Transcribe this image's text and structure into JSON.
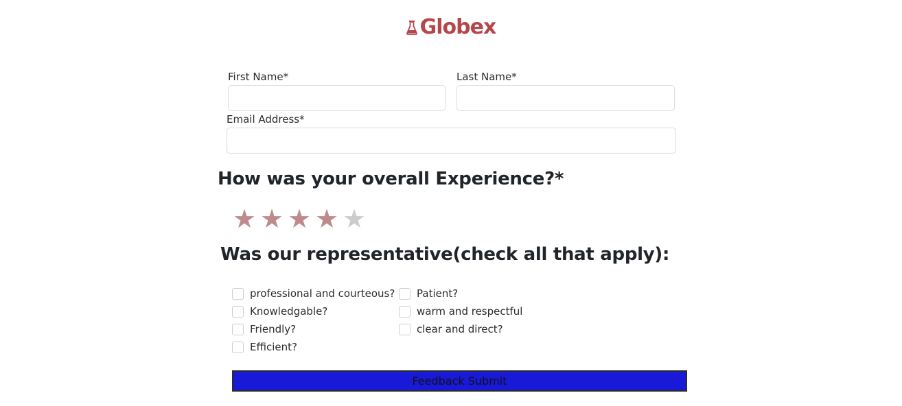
{
  "brand": {
    "name": "Globex",
    "icon": "flask-icon",
    "color": "#b5474b"
  },
  "form": {
    "first_name": {
      "label": "First Name*",
      "value": ""
    },
    "last_name": {
      "label": "Last Name*",
      "value": ""
    },
    "email": {
      "label": "Email Address*",
      "value": ""
    }
  },
  "rating": {
    "question": "How was your overall Experience?*",
    "max": 5,
    "value": 4,
    "filled_color": "#bf8a8c",
    "empty_color": "#cccccc"
  },
  "representative": {
    "question": "Was our representative(check all that apply):",
    "options": [
      {
        "label": "professional and courteous?",
        "checked": false
      },
      {
        "label": "Knowledgable?",
        "checked": false
      },
      {
        "label": "Friendly?",
        "checked": false
      },
      {
        "label": "Efficient?",
        "checked": false
      },
      {
        "label": "Patient?",
        "checked": false
      },
      {
        "label": "warm and respectful",
        "checked": false
      },
      {
        "label": "clear and direct?",
        "checked": false
      }
    ]
  },
  "submit": {
    "label": "Feedback Submit",
    "color": "#1919d8"
  }
}
